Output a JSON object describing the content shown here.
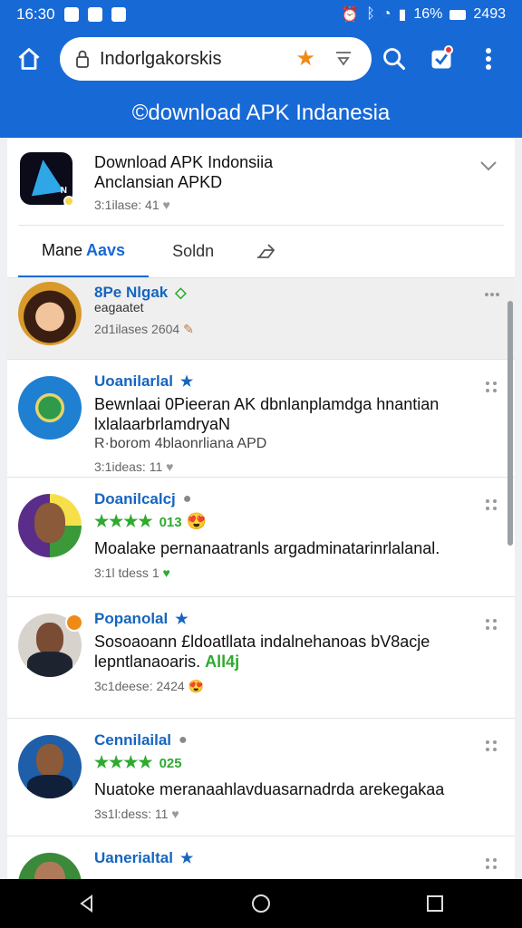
{
  "status": {
    "time": "16:30",
    "battery_text": "16%",
    "clock_right": "2493"
  },
  "toolbar": {
    "url_value": "Indorlgakorskis",
    "star_icon": "star-icon",
    "colors": {
      "bar": "#1769d6",
      "star": "#f08a17"
    }
  },
  "banner": {
    "title": "©download APK Indanesia"
  },
  "app": {
    "title": "Download APK Indonsiia",
    "subtitle": "Anclansian APKD",
    "meta": "3:1ilase: 41"
  },
  "tabs": [
    {
      "label": "Mane",
      "accent": "Aavs"
    },
    {
      "label": "Soldn"
    }
  ],
  "items": [
    {
      "title": "8Pe Nlgak",
      "subtitle": "eagaatet",
      "meta": "2d1ilases 2604",
      "badge": "check"
    },
    {
      "title": "Uoanilarlal",
      "body": "Bewnlaai 0Pieeran AK dbnlanplamdga hnantian lxlalaarbrlamdryaN",
      "extra": "R·borom 4blaonrliana APD",
      "meta": "3:1ideas: 11",
      "badge": "star"
    },
    {
      "title": "Doanilcalcj",
      "stars": "★★★★",
      "stars_num": "013",
      "body": "Moalake pernanaatranls argadminatarinrlalanal.",
      "meta": "3:1l tdess 1",
      "badge": "gray"
    },
    {
      "title": "Popanolal",
      "body": "Sosoaoann £ldoatllata indalnehanoas bV8acje",
      "body2": "lepntlanaoaris.",
      "body2_accent": "All4j",
      "meta": "3c1deese: 2424",
      "badge": "star"
    },
    {
      "title": "Cennilailal",
      "stars": "★★★★",
      "stars_num": "025",
      "body": "Nuatoke meranaahlavduasarnadrda arekegakaa",
      "meta": "3s1l:dess: 11",
      "badge": "gray"
    },
    {
      "title": "Uanerialtal",
      "badge": "star"
    }
  ]
}
